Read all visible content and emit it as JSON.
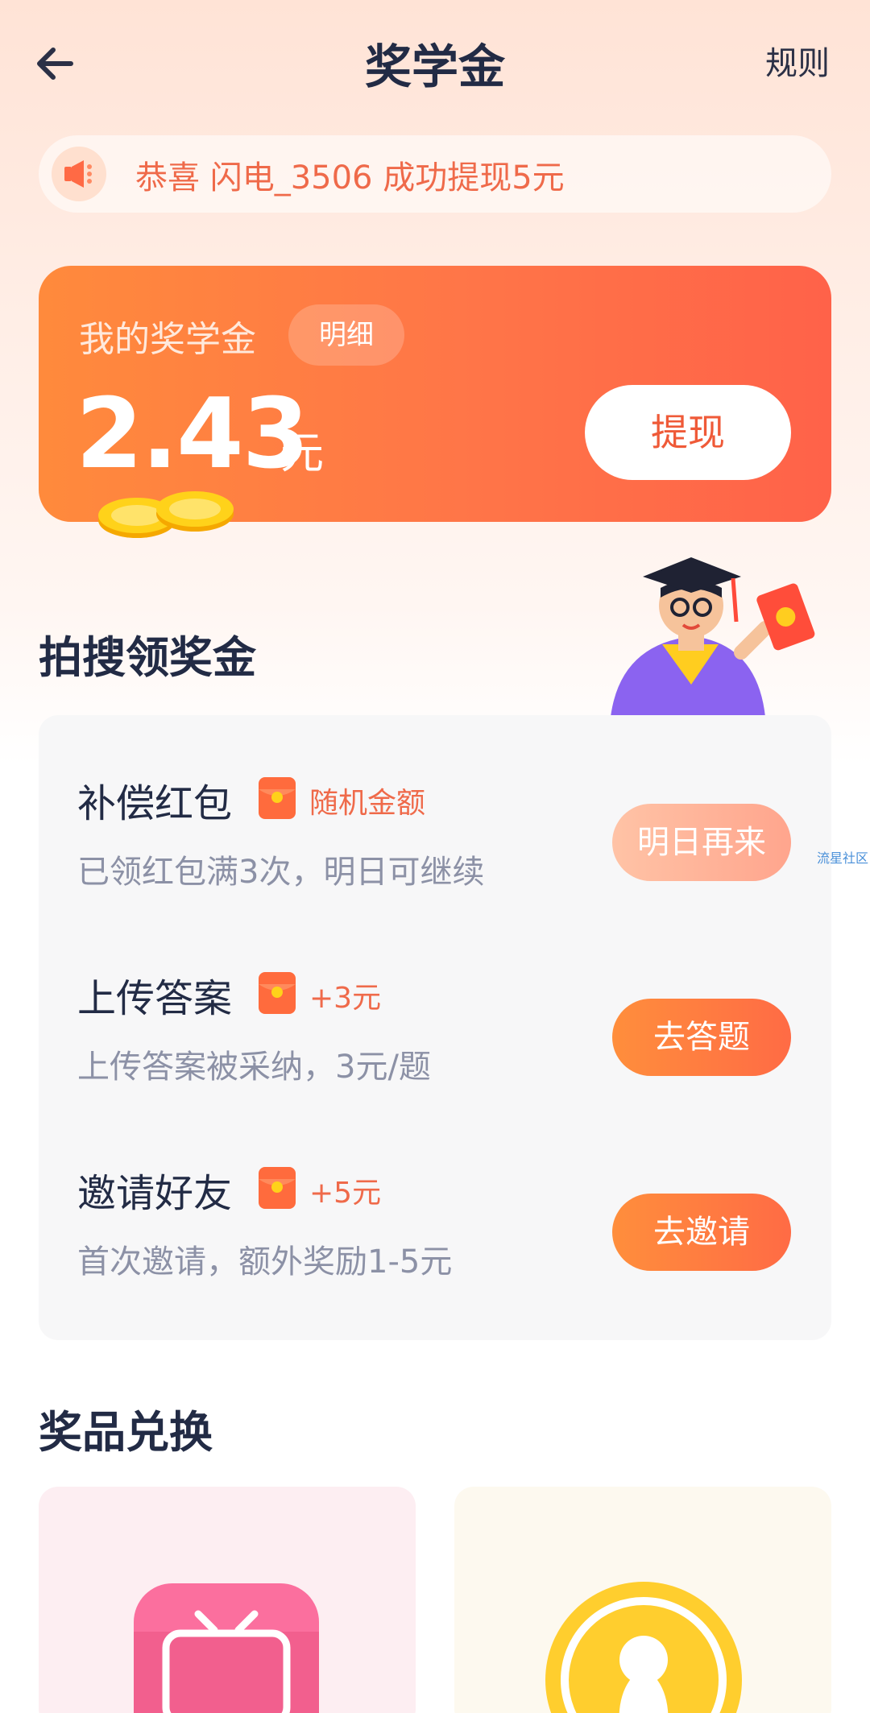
{
  "header": {
    "title": "奖学金",
    "rules_label": "规则"
  },
  "notice": {
    "text": "恭喜 闪电_3506 成功提现5元"
  },
  "balance": {
    "label": "我的奖学金",
    "detail_label": "明细",
    "amount": "2.43",
    "unit": "元",
    "withdraw_label": "提现"
  },
  "tasks_section": {
    "title": "拍搜领奖金",
    "items": [
      {
        "name": "补偿红包",
        "reward": "随机金额",
        "desc": "已领红包满3次，明日可继续",
        "button": "明日再来",
        "button_state": "disabled"
      },
      {
        "name": "上传答案",
        "reward": "+3元",
        "desc": "上传答案被采纳，3元/题",
        "button": "去答题",
        "button_state": "enabled"
      },
      {
        "name": "邀请好友",
        "reward": "+5元",
        "desc": "首次邀请，额外奖励1-5元",
        "button": "去邀请",
        "button_state": "enabled"
      }
    ]
  },
  "prize_section": {
    "title": "奖品兑换"
  },
  "watermark": "流星社区",
  "colors": {
    "accent": "#ff7548",
    "primary_text": "#222b45",
    "reward_text": "#ef6a4a",
    "muted_text": "#8c91a6"
  }
}
